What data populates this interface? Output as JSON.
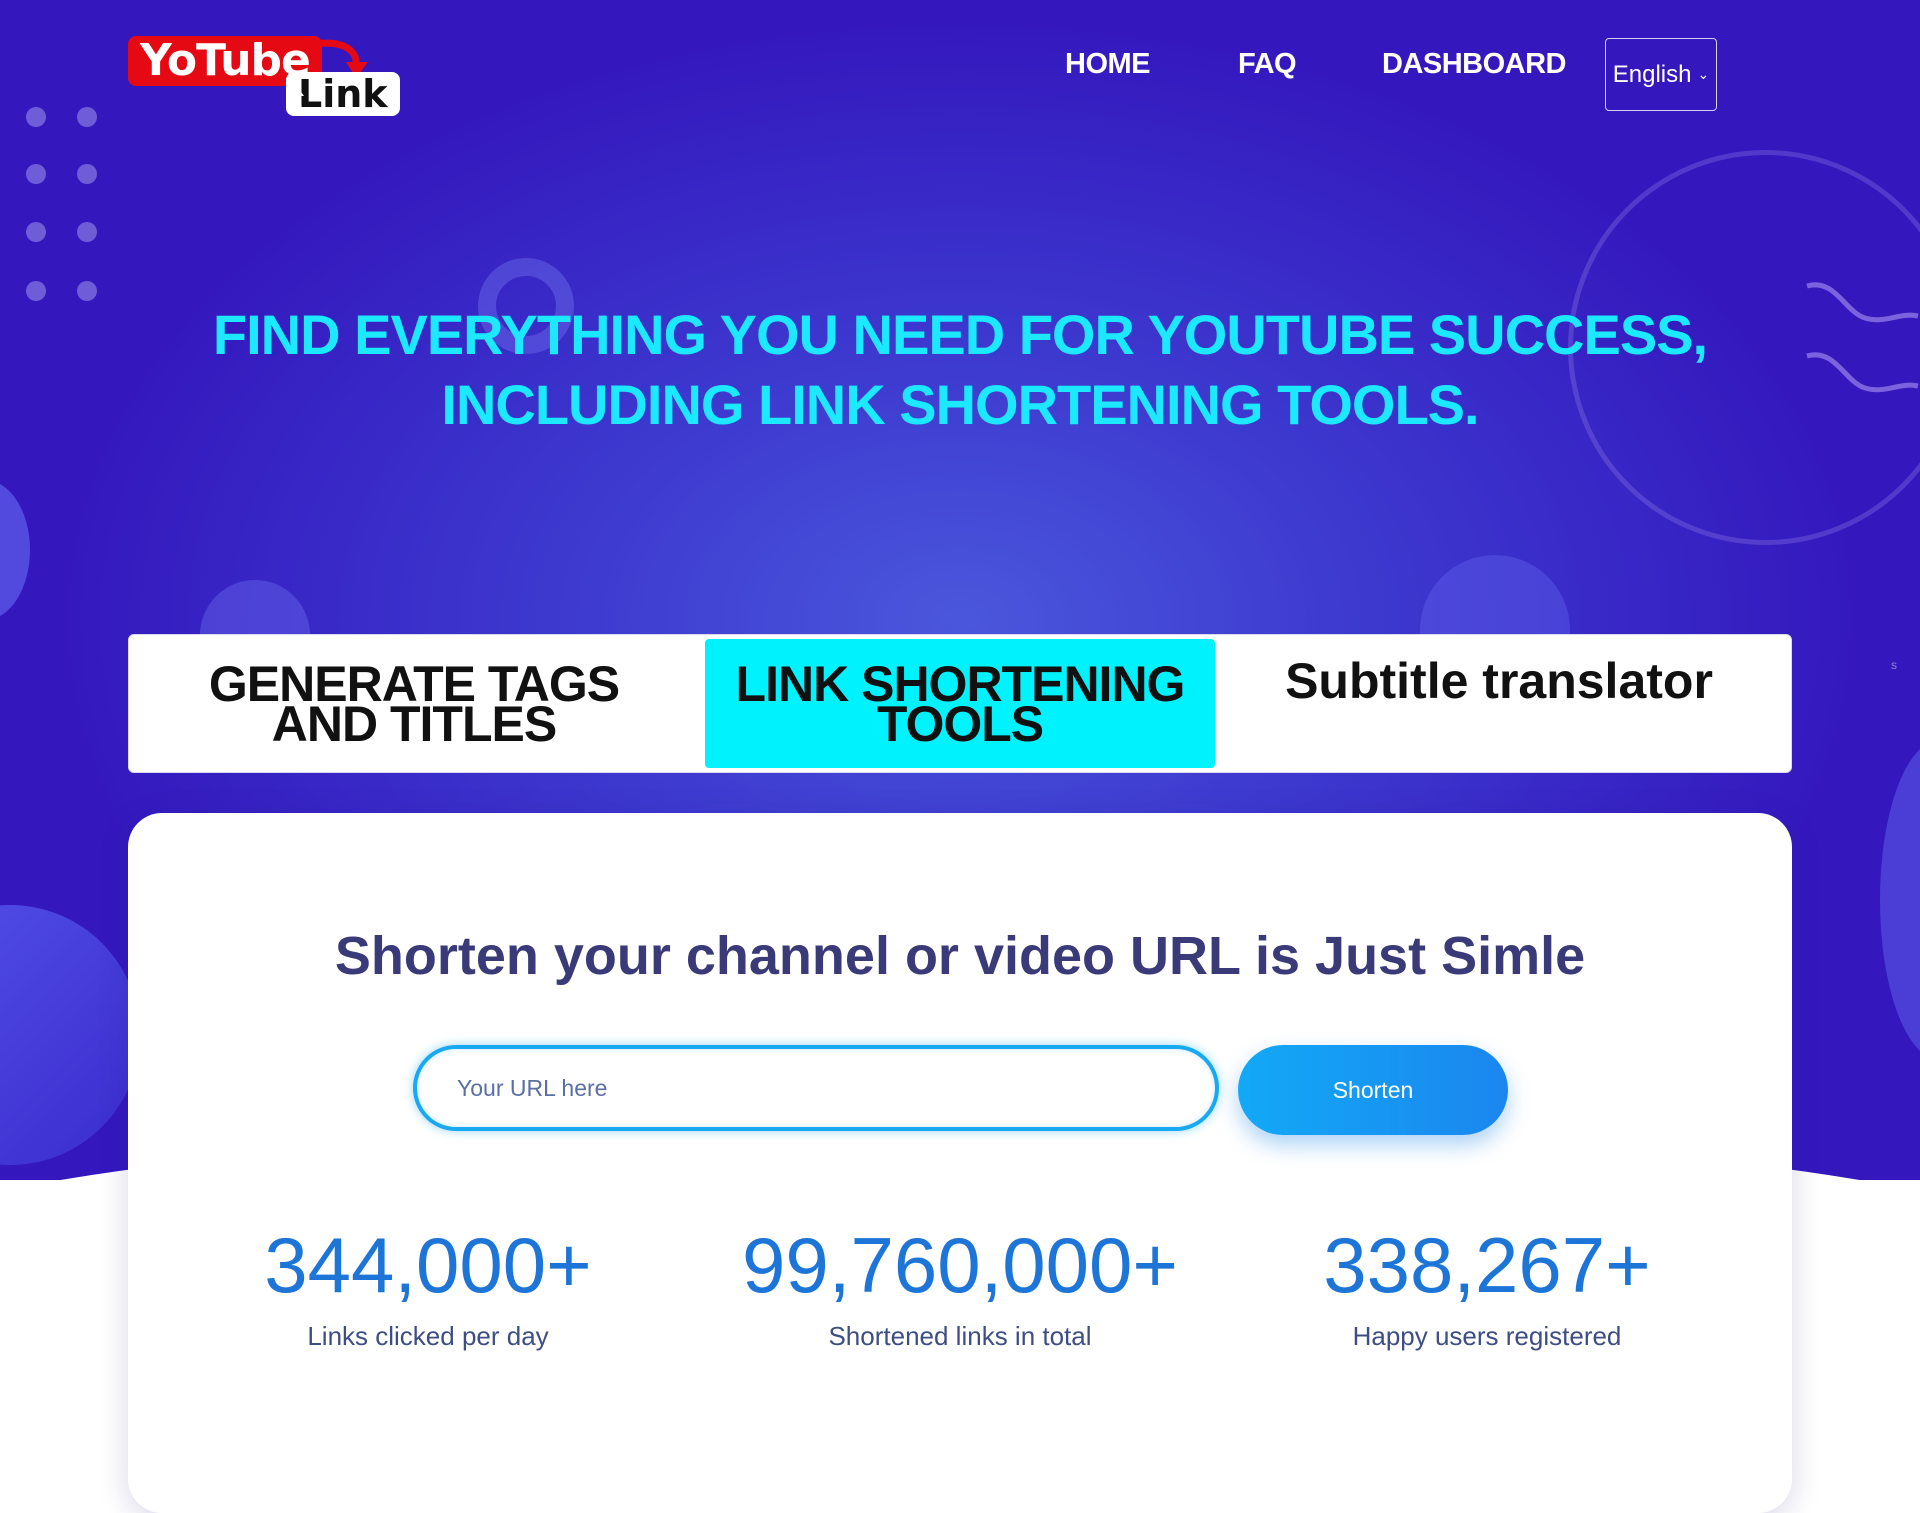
{
  "logo": {
    "top_text": "YoTube",
    "bottom_text": "Link",
    "colors": {
      "red": "#e50914",
      "white": "#ffffff"
    }
  },
  "nav": {
    "items": [
      {
        "label": "HOME"
      },
      {
        "label": "FAQ"
      },
      {
        "label": "DASHBOARD"
      }
    ],
    "language": {
      "selected": "English",
      "icon": "chevron-down-icon"
    }
  },
  "hero": {
    "headline_line1": "FIND EVERYTHING YOU NEED FOR YOUTUBE SUCCESS,",
    "headline_line2": "INCLUDING LINK SHORTENING TOOLS.",
    "accent_color": "#1ce8ff"
  },
  "tabs": [
    {
      "line1": "GENERATE TAGS",
      "line2": "AND TITLES",
      "active": false
    },
    {
      "line1": "LINK SHORTENING",
      "line2": "TOOLS",
      "active": true
    },
    {
      "label": "Subtitle translator",
      "active": false
    }
  ],
  "shortener": {
    "title": "Shorten your channel or video URL is Just Simle",
    "input_value": "",
    "input_placeholder": "Your URL here",
    "button_label": "Shorten"
  },
  "stats": [
    {
      "value": "344,000+",
      "label": "Links clicked per day"
    },
    {
      "value": "99,760,000+",
      "label": "Shortened links in total"
    },
    {
      "value": "338,267+",
      "label": "Happy users registered"
    }
  ],
  "stray_glyph": "s",
  "colors": {
    "active_tab": "#00f2fd",
    "stat_blue": "#1e75d8",
    "button_blue": "#12a9f6"
  }
}
